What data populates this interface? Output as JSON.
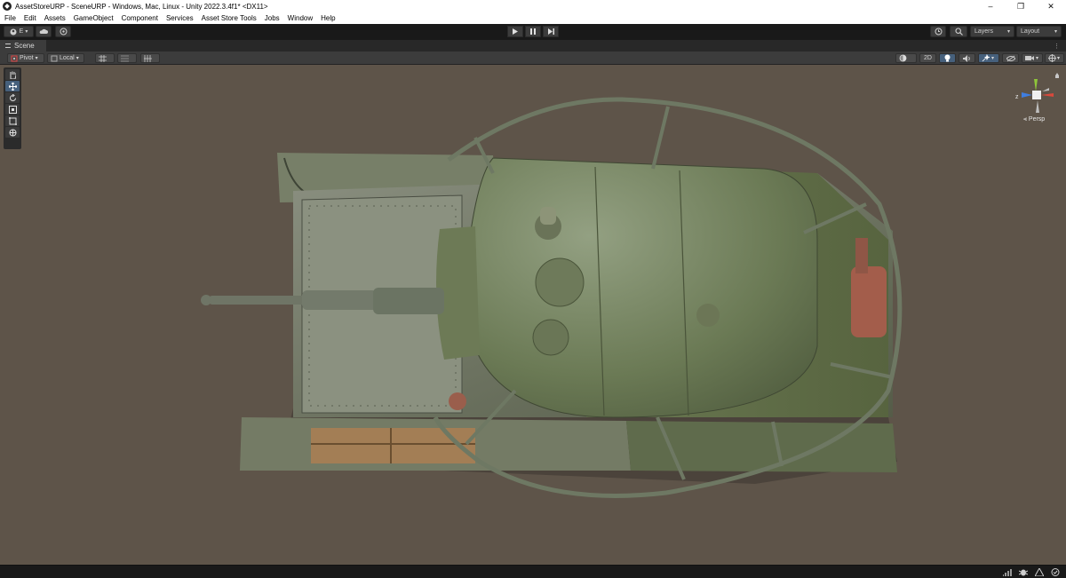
{
  "window": {
    "title": "AssetStoreURP - SceneURP - Windows, Mac, Linux - Unity 2022.3.4f1* <DX11>",
    "minimize": "–",
    "restore": "❐",
    "close": "✕"
  },
  "menu": {
    "items": [
      "File",
      "Edit",
      "Assets",
      "GameObject",
      "Component",
      "Services",
      "Asset Store Tools",
      "Jobs",
      "Window",
      "Help"
    ]
  },
  "toolbar": {
    "account_initial": "E",
    "layers_label": "Layers",
    "layout_label": "Layout"
  },
  "tabs": {
    "scene_label": "Scene"
  },
  "scene_toolbar": {
    "pivot_label": "Pivot",
    "local_label": "Local",
    "mode_2d_label": "2D"
  },
  "gizmo": {
    "projection_label": "Persp",
    "z_axis_label": "z"
  },
  "colors": {
    "accent": "#46607c",
    "viewport_bg": "#5e5449",
    "tank_body": "#5d6b4a",
    "axis_x": "#d9493c",
    "axis_y": "#8fc73a",
    "axis_z": "#3f7ee0"
  },
  "icons": {
    "palette": [
      "hand-icon",
      "move-icon",
      "rotate-icon",
      "scale-icon",
      "rect-icon",
      "transform-icon"
    ],
    "status": [
      "network-icon",
      "bug-icon",
      "hint-icon",
      "collab-icon"
    ]
  }
}
